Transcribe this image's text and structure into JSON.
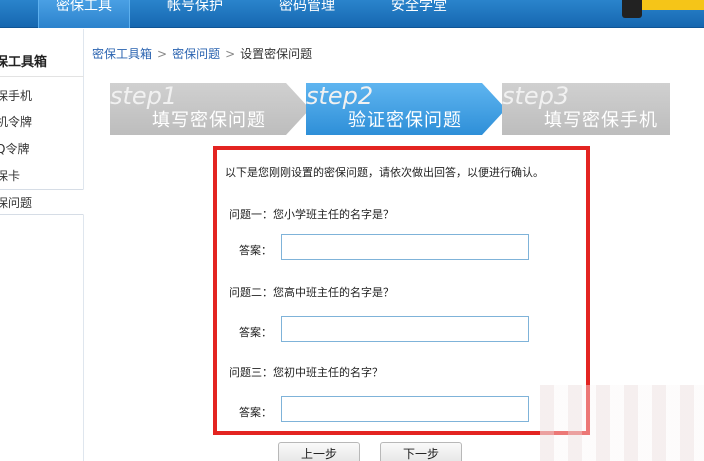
{
  "nav": {
    "items": [
      "密保工具",
      "帐号保护",
      "密码管理",
      "安全学堂"
    ]
  },
  "sidebar": {
    "title": "保工具箱",
    "items": [
      {
        "label": "保手机",
        "active": false
      },
      {
        "label": "机令牌",
        "active": false
      },
      {
        "label": "Q令牌",
        "active": false
      },
      {
        "label": "保卡",
        "active": false
      },
      {
        "label": "保问题",
        "active": true
      }
    ]
  },
  "breadcrumb": {
    "items": [
      "密保工具箱",
      "密保问题",
      "设置密保问题"
    ],
    "separator": ">"
  },
  "steps": [
    {
      "num": "step1",
      "label": "填写密保问题",
      "state": "done"
    },
    {
      "num": "step2",
      "label": "验证密保问题",
      "state": "current"
    },
    {
      "num": "step3",
      "label": "填写密保手机",
      "state": "todo"
    }
  ],
  "form": {
    "intro": "以下是您刚刚设置的密保问题，请依次做出回答，以便进行确认。",
    "questions": [
      {
        "question": "问题一：您小学班主任的名字是？",
        "answer_label": "答案：",
        "answer_value": ""
      },
      {
        "question": "问题二：您高中班主任的名字是？",
        "answer_label": "答案：",
        "answer_value": ""
      },
      {
        "question": "问题三：您初中班主任的名字？",
        "answer_label": "答案：",
        "answer_value": ""
      }
    ]
  },
  "buttons": {
    "prev": "上一步",
    "next": "下一步"
  },
  "colors": {
    "nav_bg": "#1d72bd",
    "highlight_border": "#e32421",
    "step_active": "#3a98de",
    "step_inactive": "#c6c6c6",
    "link": "#2a63b0"
  }
}
